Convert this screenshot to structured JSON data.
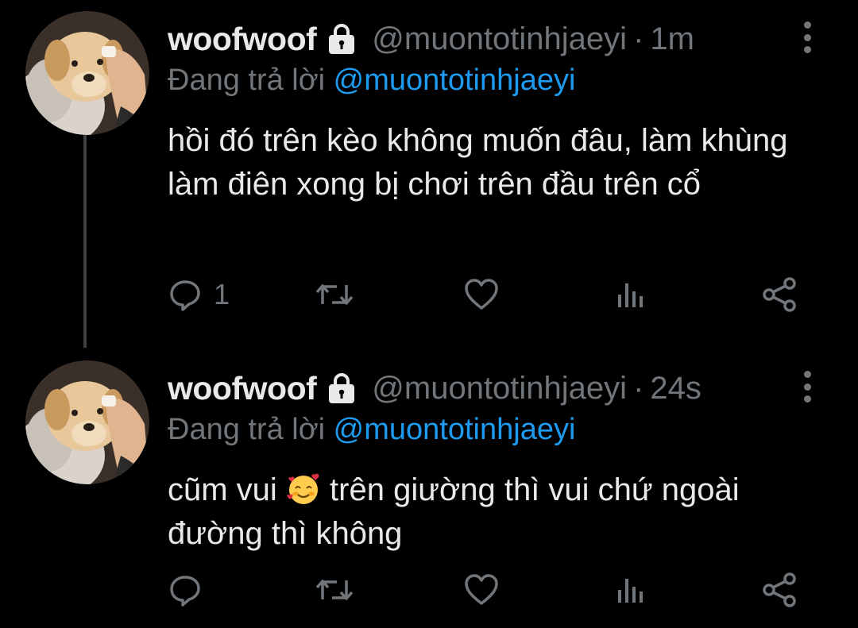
{
  "colors": {
    "background": "#000000",
    "text_primary": "#e7e9ea",
    "text_secondary": "#71767b",
    "link_blue": "#1d9bf0",
    "thread_line": "#3e4144"
  },
  "tweets": [
    {
      "display_name": "woofwoof",
      "handle": "@muontotinhjaeyi",
      "separator": "·",
      "time": "1m",
      "protected_icon": "lock-icon",
      "replying_to_label": "Đang trả lời",
      "replying_to_handle": "@muontotinhjaeyi",
      "text_part1": "hồi đó trên kèo không muốn đâu, làm khùng làm điên xong bị chơi trên đầu trên cổ",
      "text_emoji": "",
      "text_part2": "",
      "actions": {
        "reply_count": "1",
        "retweet_count": "",
        "like_count": "",
        "views_count": ""
      }
    },
    {
      "display_name": "woofwoof",
      "handle": "@muontotinhjaeyi",
      "separator": "·",
      "time": "24s",
      "protected_icon": "lock-icon",
      "replying_to_label": "Đang trả lời",
      "replying_to_handle": "@muontotinhjaeyi",
      "text_part1": "cũm vui ",
      "text_emoji": "smiling-face-with-hearts-icon",
      "text_part2": " trên giường thì vui chứ ngoài đường thì không",
      "actions": {
        "reply_count": "",
        "retweet_count": "",
        "like_count": "",
        "views_count": ""
      }
    }
  ]
}
